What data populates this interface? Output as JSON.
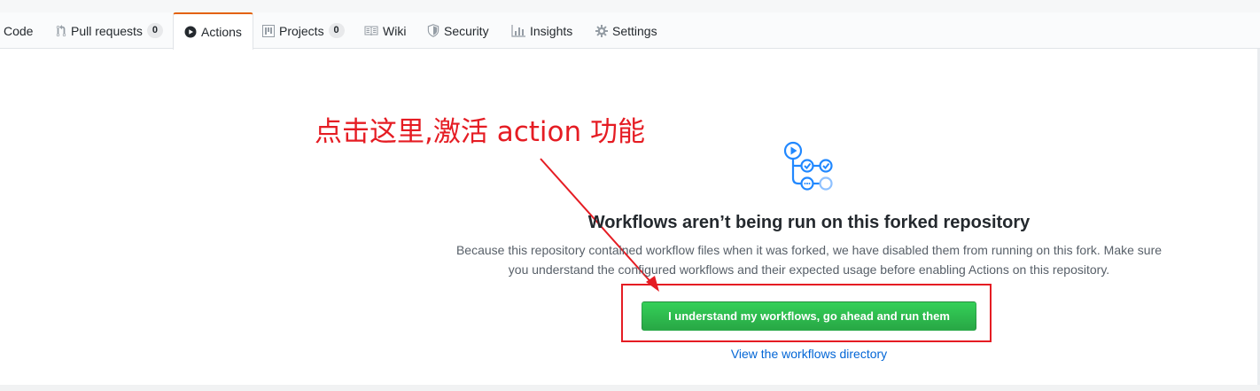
{
  "tabs": [
    {
      "label": "Code",
      "icon": "code-icon",
      "counter": null
    },
    {
      "label": "Pull requests",
      "icon": "pull-request-icon",
      "counter": "0"
    },
    {
      "label": "Actions",
      "icon": "play-icon",
      "counter": null,
      "active": true
    },
    {
      "label": "Projects",
      "icon": "project-icon",
      "counter": "0"
    },
    {
      "label": "Wiki",
      "icon": "book-icon",
      "counter": null
    },
    {
      "label": "Security",
      "icon": "shield-icon",
      "counter": null
    },
    {
      "label": "Insights",
      "icon": "graph-icon",
      "counter": null
    },
    {
      "label": "Settings",
      "icon": "gear-icon",
      "counter": null
    }
  ],
  "annotation": {
    "text": "点击这里,激活 action 功能",
    "color": "#e51c23"
  },
  "main": {
    "icon": "workflow-icon",
    "heading": "Workflows aren’t being run on this forked repository",
    "description_line1": "Because this repository contained workflow files when it was forked, we have disabled them from running on this fork. Make sure",
    "description_line2": "you understand the configured workflows and their expected usage before enabling Actions on this repository.",
    "run_button_label": "I understand my workflows, go ahead and run them",
    "directory_link": "View the workflows directory"
  },
  "colors": {
    "active_tab_accent": "#e36209",
    "primary_button": "#28a745",
    "link": "#0366d6",
    "workflow_icon": "#2188ff"
  }
}
